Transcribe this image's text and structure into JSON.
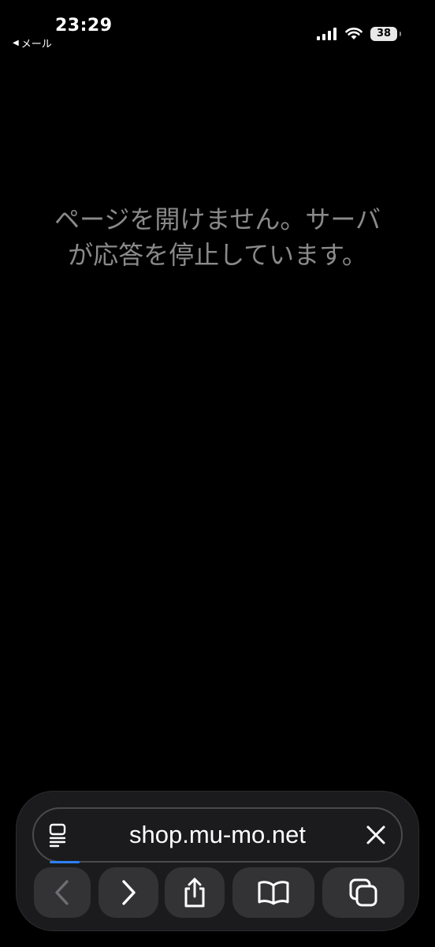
{
  "status_bar": {
    "time": "23:29",
    "back_label": "メール",
    "back_arrow": "◀",
    "battery": "38",
    "icons": [
      "cellular-signal-icon",
      "wifi-icon",
      "battery-icon"
    ]
  },
  "error": {
    "message": "ページを開けません。サーバが応答を停止しています。"
  },
  "address_bar": {
    "url": "shop.mu-mo.net",
    "loading_progress": 0.08
  },
  "toolbar": {
    "buttons": [
      "back-button",
      "forward-button",
      "share-button",
      "bookmarks-button",
      "tabs-button"
    ],
    "back_enabled": false
  },
  "colors": {
    "background": "#000000",
    "panel": "#1b1b1d",
    "button": "#333336",
    "message_text": "#8a8a8a",
    "progress": "#2d7ff9"
  }
}
